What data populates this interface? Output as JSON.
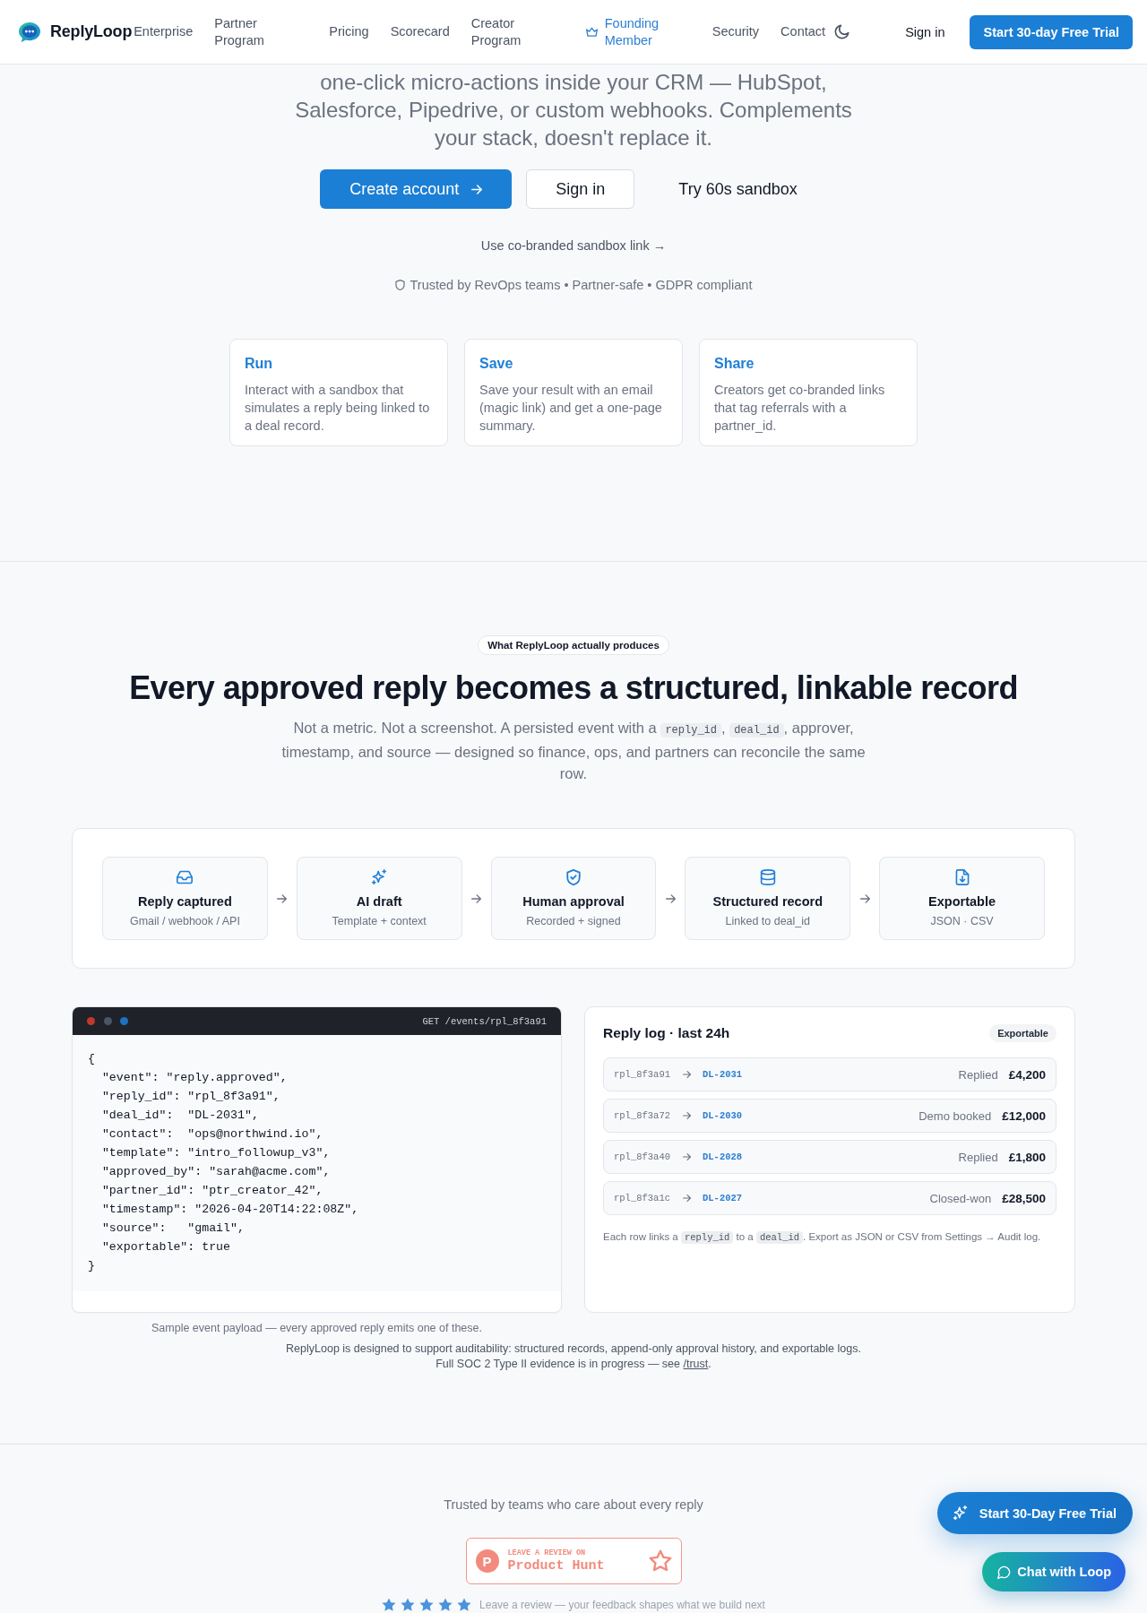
{
  "header": {
    "logo": "ReplyLoop",
    "nav": [
      {
        "label": "Enterprise",
        "kind": "link"
      },
      {
        "label": "Partner Program",
        "kind": "link"
      },
      {
        "label": "Pricing",
        "kind": "link"
      },
      {
        "label": "Scorecard",
        "kind": "link"
      },
      {
        "label": "Creator Program",
        "kind": "link"
      },
      {
        "label": "Founding Member",
        "kind": "featured"
      },
      {
        "label": "Security",
        "kind": "link"
      },
      {
        "label": "Contact",
        "kind": "link"
      }
    ],
    "sign_in": "Sign in",
    "cta": "Start 30-day Free Trial"
  },
  "hero": {
    "intro": "one-click micro-actions inside your CRM — HubSpot, Salesforce, Pipedrive, or custom webhooks. Complements your stack, doesn't replace it.",
    "buttons": [
      {
        "label": "Create account",
        "kind": "primary"
      },
      {
        "label": "Sign in",
        "kind": "secondary"
      },
      {
        "label": "Try 60s sandbox",
        "kind": "ghost"
      }
    ],
    "sandbox_link": "Use co-branded sandbox link →",
    "trust_line": "Trusted by RevOps teams • Partner-safe • GDPR compliant",
    "cards": [
      {
        "title": "Run",
        "text": "Interact with a sandbox that simulates a reply being linked to a deal record."
      },
      {
        "title": "Save",
        "text": "Save your result with an email (magic link) and get a one-page summary."
      },
      {
        "title": "Share",
        "text": "Creators get co-branded links that tag referrals with a partner_id."
      }
    ]
  },
  "records": {
    "badge": "What ReplyLoop actually produces",
    "heading": "Every approved reply becomes a structured, linkable record",
    "intro": [
      {
        "text": "Not a metric. Not a screenshot. A persisted event with a "
      },
      {
        "code": "reply_id"
      },
      {
        "text": ", "
      },
      {
        "code": "deal_id"
      },
      {
        "text": ", approver, timestamp, and source — designed so finance, ops, and partners can reconcile the same row."
      }
    ],
    "pipeline": [
      {
        "title": "Reply captured",
        "subtitle": "Gmail / webhook / API"
      },
      {
        "title": "AI draft",
        "subtitle": "Template + context"
      },
      {
        "title": "Human approval",
        "subtitle": "Recorded + signed"
      },
      {
        "title": "Structured record",
        "subtitle": "Linked to deal_id"
      },
      {
        "title": "Exportable",
        "subtitle": "JSON · CSV"
      }
    ],
    "payload": {
      "request": "GET /events/rpl_8f3a91",
      "code_lines": [
        "{",
        "  \"event\": \"reply.approved\",",
        "  \"reply_id\": \"rpl_8f3a91\",",
        "  \"deal_id\":  \"DL-2031\",",
        "  \"contact\":  \"ops@northwind.io\",",
        "  \"template\": \"intro_followup_v3\",",
        "  \"approved_by\": \"sarah@acme.com\",",
        "  \"partner_id\": \"ptr_creator_42\",",
        "  \"timestamp\": \"2026-04-20T14:22:08Z\",",
        "  \"source\":   \"gmail\",",
        "  \"exportable\": true",
        "}"
      ],
      "caption": "Sample event payload — every approved reply emits one of these."
    },
    "log": {
      "title": "Reply log · last 24h",
      "tag": "Exportable",
      "rows": [
        {
          "reply_id": "rpl_8f3a91",
          "deal_id": "DL-2031",
          "status": "Replied",
          "amount": "£4,200"
        },
        {
          "reply_id": "rpl_8f3a72",
          "deal_id": "DL-2030",
          "status": "Demo booked",
          "amount": "£12,000"
        },
        {
          "reply_id": "rpl_8f3a40",
          "deal_id": "DL-2028",
          "status": "Replied",
          "amount": "£1,800"
        },
        {
          "reply_id": "rpl_8f3a1c",
          "deal_id": "DL-2027",
          "status": "Closed-won",
          "amount": "£28,500"
        }
      ],
      "footnote": [
        {
          "text": "Each row links a "
        },
        {
          "code": "reply_id"
        },
        {
          "text": " to a "
        },
        {
          "code": "deal_id"
        },
        {
          "text": ". Export as JSON or CSV from Settings → Audit log."
        }
      ]
    },
    "notes": [
      [
        {
          "text": "ReplyLoop is designed to support auditability: structured records, append-only approval history, and exportable logs."
        }
      ],
      [
        {
          "text": "Full SOC 2 Type II evidence is in progress — see "
        },
        {
          "link": "/trust"
        },
        {
          "text": "."
        }
      ]
    ]
  },
  "footer": {
    "tagline": "Trusted by teams who care about every reply",
    "product_hunt": {
      "mark": "P",
      "kicker": "LEAVE A REVIEW ON",
      "name": "Product Hunt"
    },
    "rating": {
      "stars": 5,
      "text": "Leave a review — your feedback shapes what we build next"
    }
  },
  "floating": {
    "trial": "Start 30-Day Free Trial",
    "chat": "Chat with Loop"
  }
}
